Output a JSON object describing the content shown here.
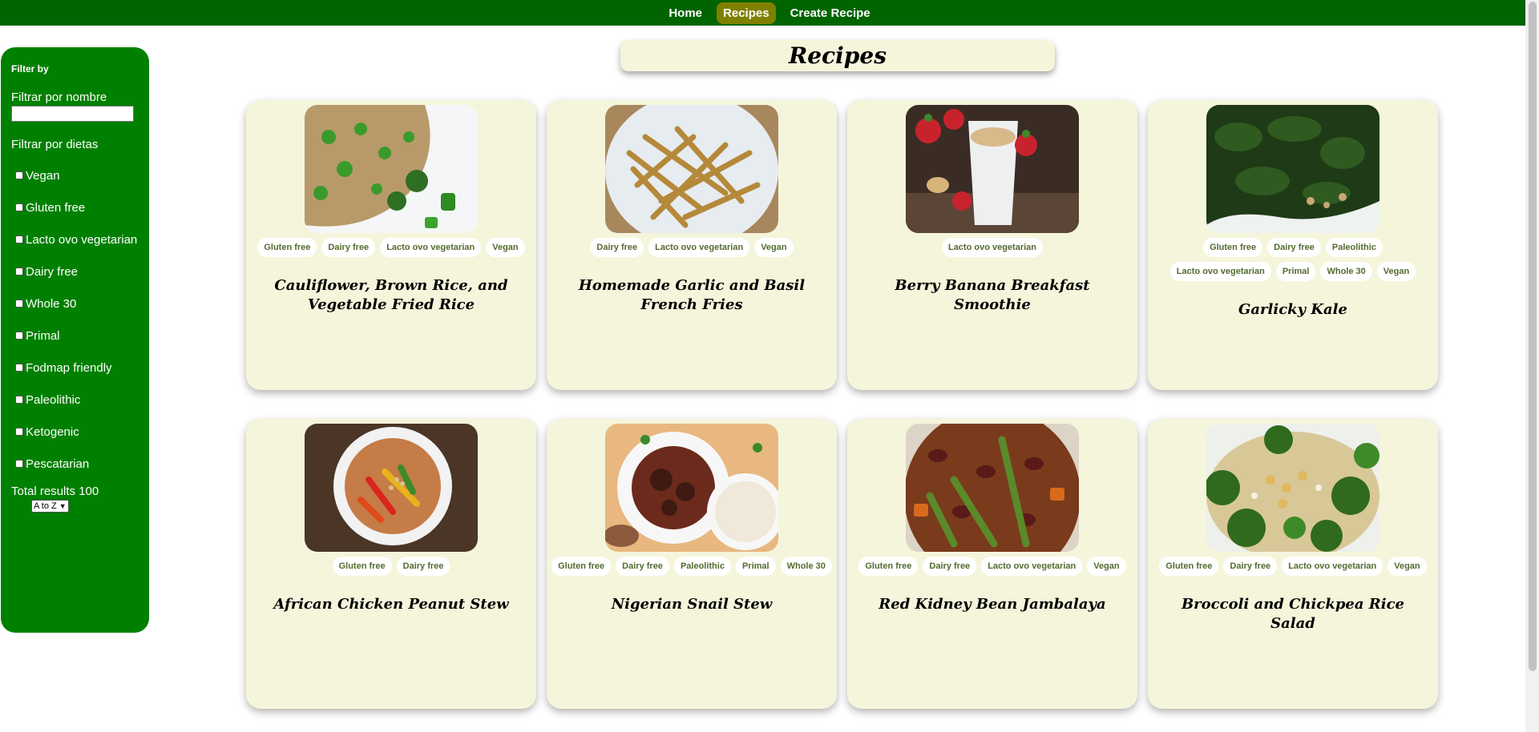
{
  "nav": {
    "items": [
      {
        "label": "Home",
        "active": false
      },
      {
        "label": "Recipes",
        "active": true
      },
      {
        "label": "Create Recipe",
        "active": false
      }
    ]
  },
  "sidebar": {
    "title": "Filter by",
    "name_filter_label": "Filtrar por nombre",
    "name_filter_value": "",
    "diet_filter_label": "Filtrar por dietas",
    "diets": [
      {
        "label": "Vegan",
        "checked": false
      },
      {
        "label": "Gluten free",
        "checked": false
      },
      {
        "label": "Lacto ovo vegetarian",
        "checked": false
      },
      {
        "label": "Dairy free",
        "checked": false
      },
      {
        "label": "Whole 30",
        "checked": false
      },
      {
        "label": "Primal",
        "checked": false
      },
      {
        "label": "Fodmap friendly",
        "checked": false
      },
      {
        "label": "Paleolithic",
        "checked": false
      },
      {
        "label": "Ketogenic",
        "checked": false
      },
      {
        "label": "Pescatarian",
        "checked": false
      }
    ],
    "total_label": "Total results 100",
    "sort_selected": "A to Z"
  },
  "page_title": "Recipes",
  "colors": {
    "nav_bg": "#006400",
    "nav_active": "#808000",
    "sidebar_bg": "#008000",
    "card_bg": "#f5f5dc",
    "tag_text": "#556b2f"
  },
  "recipes": [
    {
      "title": "Cauliflower, Brown Rice, and Vegetable Fried Rice",
      "image": "fried-rice",
      "tags": [
        "Gluten free",
        "Dairy free",
        "Lacto ovo vegetarian",
        "Vegan"
      ]
    },
    {
      "title": "Homemade Garlic and Basil French Fries",
      "image": "french-fries",
      "tags": [
        "Dairy free",
        "Lacto ovo vegetarian",
        "Vegan"
      ]
    },
    {
      "title": "Berry Banana Breakfast Smoothie",
      "image": "smoothie",
      "tags": [
        "Lacto ovo vegetarian"
      ]
    },
    {
      "title": "Garlicky Kale",
      "image": "kale",
      "tags": [
        "Gluten free",
        "Dairy free",
        "Paleolithic",
        "Lacto ovo vegetarian",
        "Primal",
        "Whole 30",
        "Vegan"
      ]
    },
    {
      "title": "African Chicken Peanut Stew",
      "image": "peanut-stew",
      "tags": [
        "Gluten free",
        "Dairy free"
      ]
    },
    {
      "title": "Nigerian Snail Stew",
      "image": "snail-stew",
      "tags": [
        "Gluten free",
        "Dairy free",
        "Paleolithic",
        "Primal",
        "Whole 30"
      ]
    },
    {
      "title": "Red Kidney Bean Jambalaya",
      "image": "jambalaya",
      "tags": [
        "Gluten free",
        "Dairy free",
        "Lacto ovo vegetarian",
        "Vegan"
      ]
    },
    {
      "title": "Broccoli and Chickpea Rice Salad",
      "image": "broccoli-salad",
      "tags": [
        "Gluten free",
        "Dairy free",
        "Lacto ovo vegetarian",
        "Vegan"
      ]
    }
  ]
}
